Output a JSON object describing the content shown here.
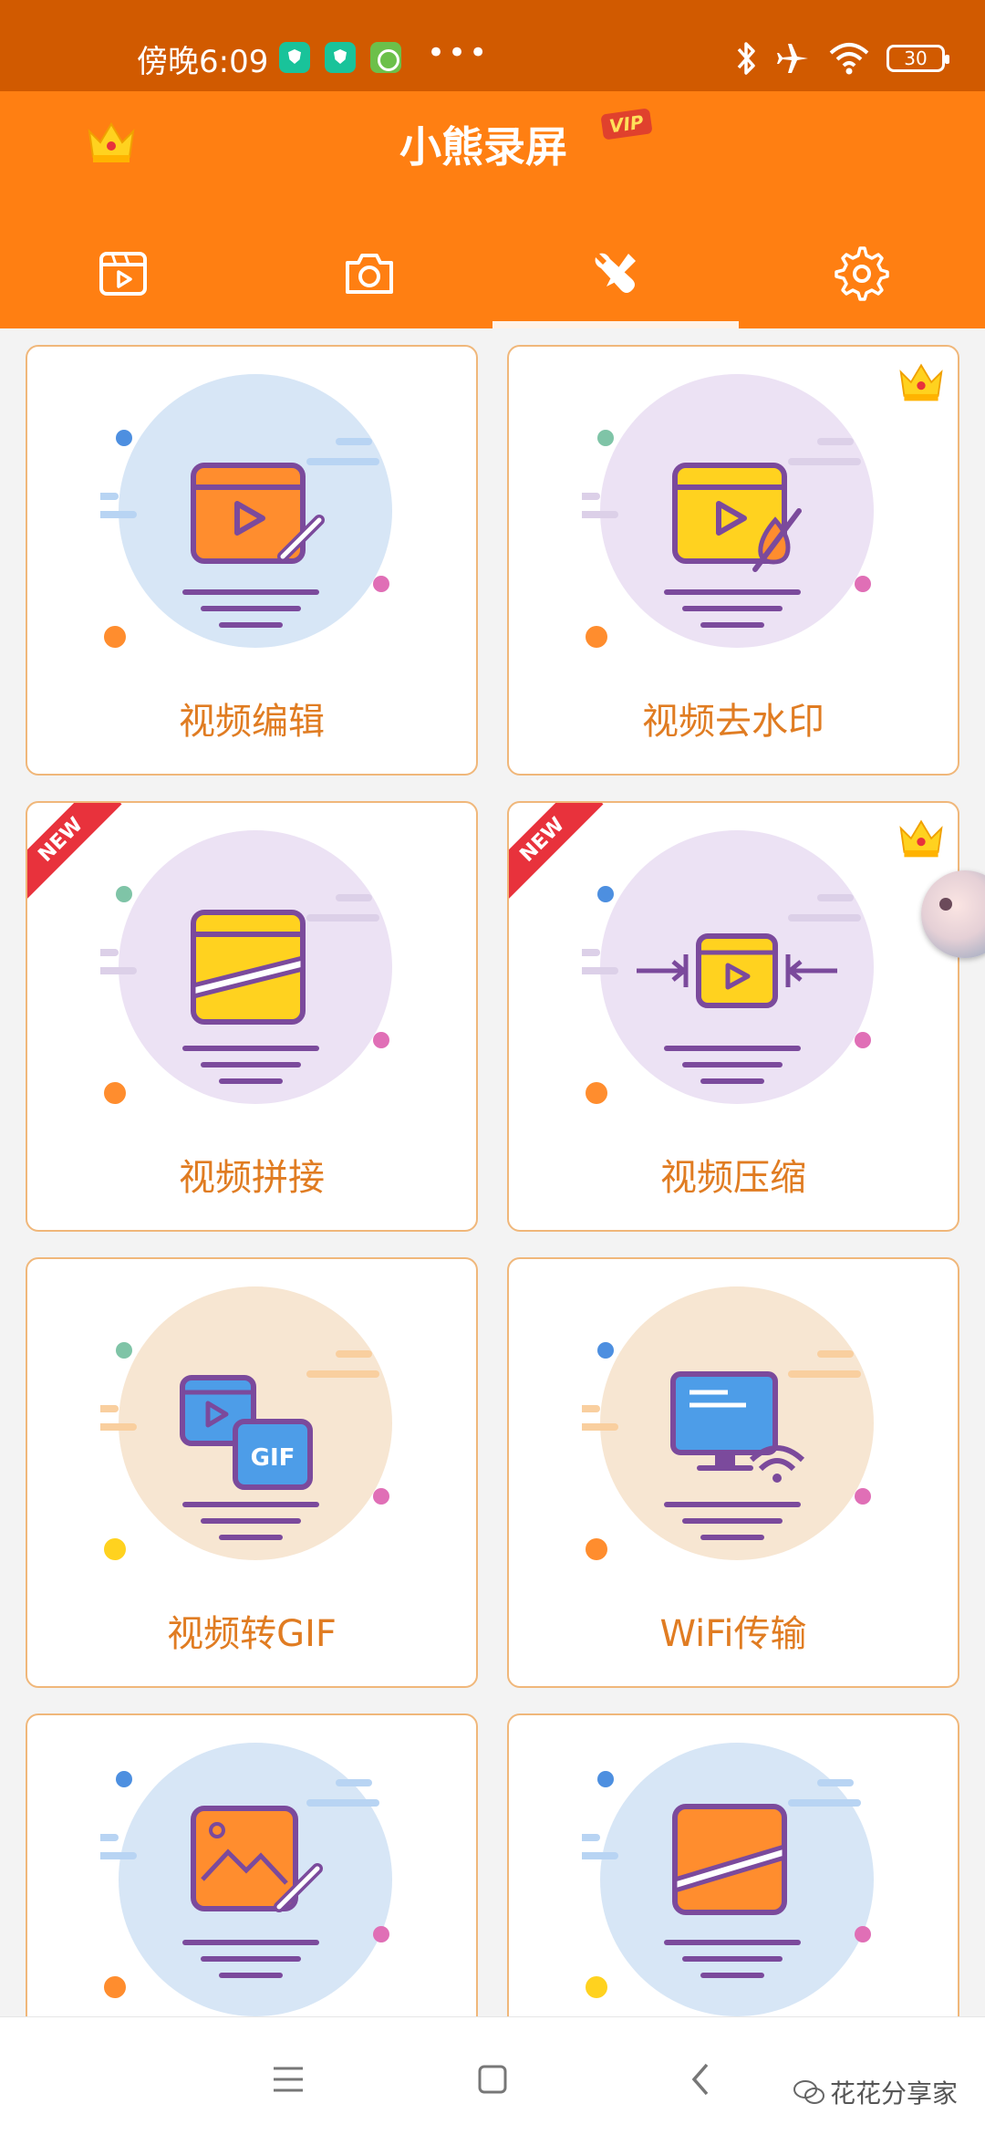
{
  "status_bar": {
    "time": "傍晚6:09",
    "more": "•••",
    "battery": "30"
  },
  "header": {
    "title": "小熊录屏",
    "vip_badge": "VIP"
  },
  "tabs": [
    {
      "name": "video-list",
      "icon": "film-icon",
      "active": false
    },
    {
      "name": "screenshot",
      "icon": "camera-icon",
      "active": false
    },
    {
      "name": "tools",
      "icon": "tools-icon",
      "active": true
    },
    {
      "name": "settings",
      "icon": "gear-icon",
      "active": false
    }
  ],
  "cards": [
    {
      "label": "视频编辑",
      "vip": false,
      "new": false
    },
    {
      "label": "视频去水印",
      "vip": true,
      "new": false
    },
    {
      "label": "视频拼接",
      "vip": false,
      "new": true
    },
    {
      "label": "视频压缩",
      "vip": true,
      "new": true
    },
    {
      "label": "视频转GIF",
      "vip": false,
      "new": false
    },
    {
      "label": "WiFi传输",
      "vip": false,
      "new": false
    },
    {
      "label": "",
      "vip": false,
      "new": false
    },
    {
      "label": "",
      "vip": false,
      "new": false
    }
  ],
  "ribbon_text": "NEW",
  "gif_text": "GIF",
  "watermark": "花花分享家",
  "colors": {
    "status_bg": "#d15a00",
    "header_bg": "#ff7f12",
    "label": "#e07c22",
    "card_border": "#f0b77a",
    "ribbon": "#e8323c",
    "purple_outline": "#7b4a9c"
  }
}
